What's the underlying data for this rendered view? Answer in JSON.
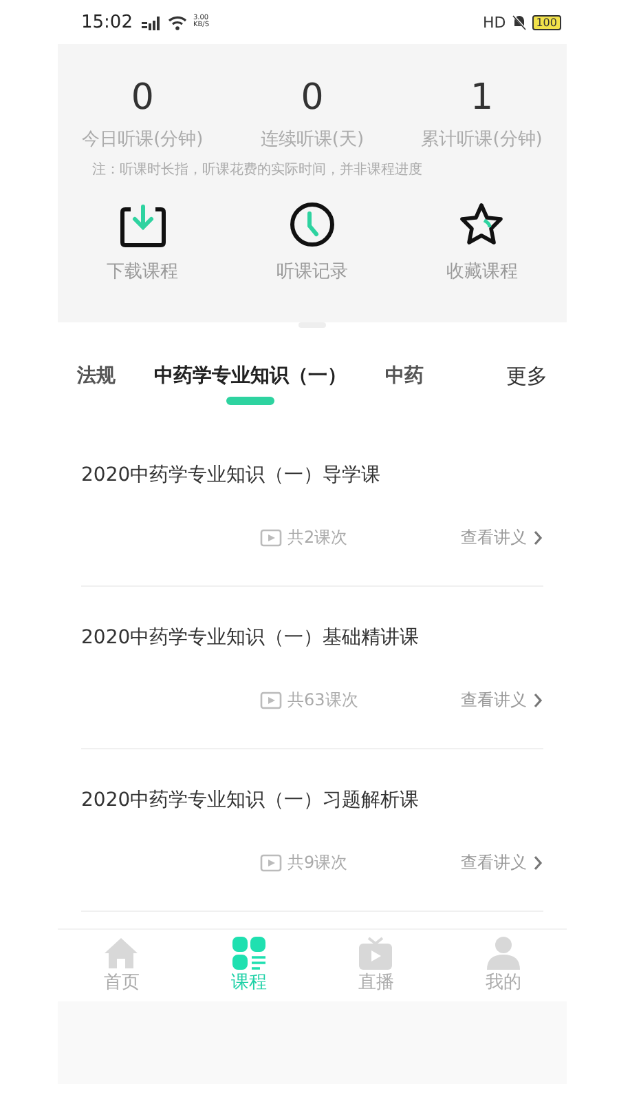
{
  "status_bar": {
    "time": "15:02",
    "speed": "3.00",
    "speed_unit": "KB/S",
    "hd": "HD",
    "battery": "100"
  },
  "stats": [
    {
      "value": "0",
      "label": "今日听课(分钟)"
    },
    {
      "value": "0",
      "label": "连续听课(天)"
    },
    {
      "value": "1",
      "label": "累计听课(分钟)"
    }
  ],
  "note": "注：听课时长指，听课花费的实际时间，并非课程进度",
  "shortcuts": [
    {
      "kind": "download",
      "label": "下载课程"
    },
    {
      "kind": "history",
      "label": "听课记录"
    },
    {
      "kind": "favorite",
      "label": "收藏课程"
    }
  ],
  "tabs": [
    {
      "label": "法规",
      "selected": false
    },
    {
      "label": "中药学专业知识（一）",
      "selected": true
    },
    {
      "label": "中药",
      "selected": false
    }
  ],
  "more": "更多",
  "courses": [
    {
      "title": "2020中药学专业知识（一）导学课",
      "count": "共2课次",
      "link": "查看讲义"
    },
    {
      "title": "2020中药学专业知识（一）基础精讲课",
      "count": "共63课次",
      "link": "查看讲义"
    },
    {
      "title": "2020中药学专业知识（一）习题解析课",
      "count": "共9课次",
      "link": "查看讲义"
    }
  ],
  "nav": [
    {
      "kind": "home",
      "label": "首页",
      "selected": false
    },
    {
      "kind": "courses",
      "label": "课程",
      "selected": true
    },
    {
      "kind": "live",
      "label": "直播",
      "selected": false
    },
    {
      "kind": "me",
      "label": "我的",
      "selected": false
    }
  ]
}
